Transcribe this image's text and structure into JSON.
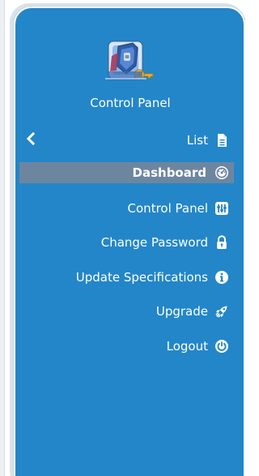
{
  "panel": {
    "title": "Control Panel",
    "accent_color": "#2386c8",
    "active_color": "#6d86a0",
    "logo_icon": "control-panel-shield-key-logo"
  },
  "back": {
    "icon": "chevron-left-icon"
  },
  "menu": {
    "items": [
      {
        "label": "List",
        "icon": "document-icon",
        "active": false
      },
      {
        "label": "Dashboard",
        "icon": "dashboard-gauge-icon",
        "active": true
      },
      {
        "label": "Control Panel",
        "icon": "sliders-icon",
        "active": false
      },
      {
        "label": "Change Password",
        "icon": "lock-icon",
        "active": false
      },
      {
        "label": "Update Specifications",
        "icon": "info-icon",
        "active": false
      },
      {
        "label": "Upgrade",
        "icon": "rocket-icon",
        "active": false
      },
      {
        "label": "Logout",
        "icon": "power-icon",
        "active": false
      }
    ]
  }
}
